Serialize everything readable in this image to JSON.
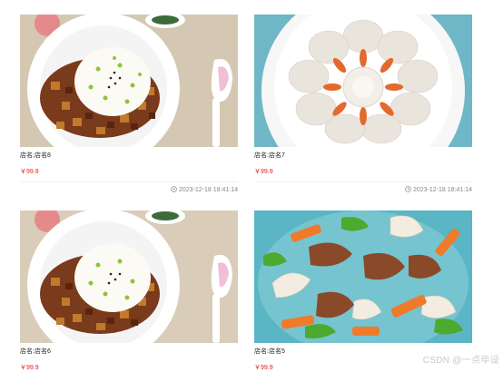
{
  "cards": [
    {
      "image": "rice-braised-pork-photo",
      "name": "店名:店名8",
      "price": "￥99.9",
      "time": "2023-12-18 18:41:14"
    },
    {
      "image": "shrimp-sashimi-photo",
      "name": "店名:店名7",
      "price": "￥99.9",
      "time": "2023-12-18 18:41:14"
    },
    {
      "image": "rice-braised-pork-photo",
      "name": "店名:店名6",
      "price": "￥99.9"
    },
    {
      "image": "stir-fried-pork-vegetables-photo",
      "name": "店名:店名5",
      "price": "￥99.9"
    }
  ],
  "watermark": "CSDN @一点毕设",
  "icons": {
    "time": "clock-icon"
  },
  "colors": {
    "price": "#e02020",
    "meta": "#888888"
  }
}
